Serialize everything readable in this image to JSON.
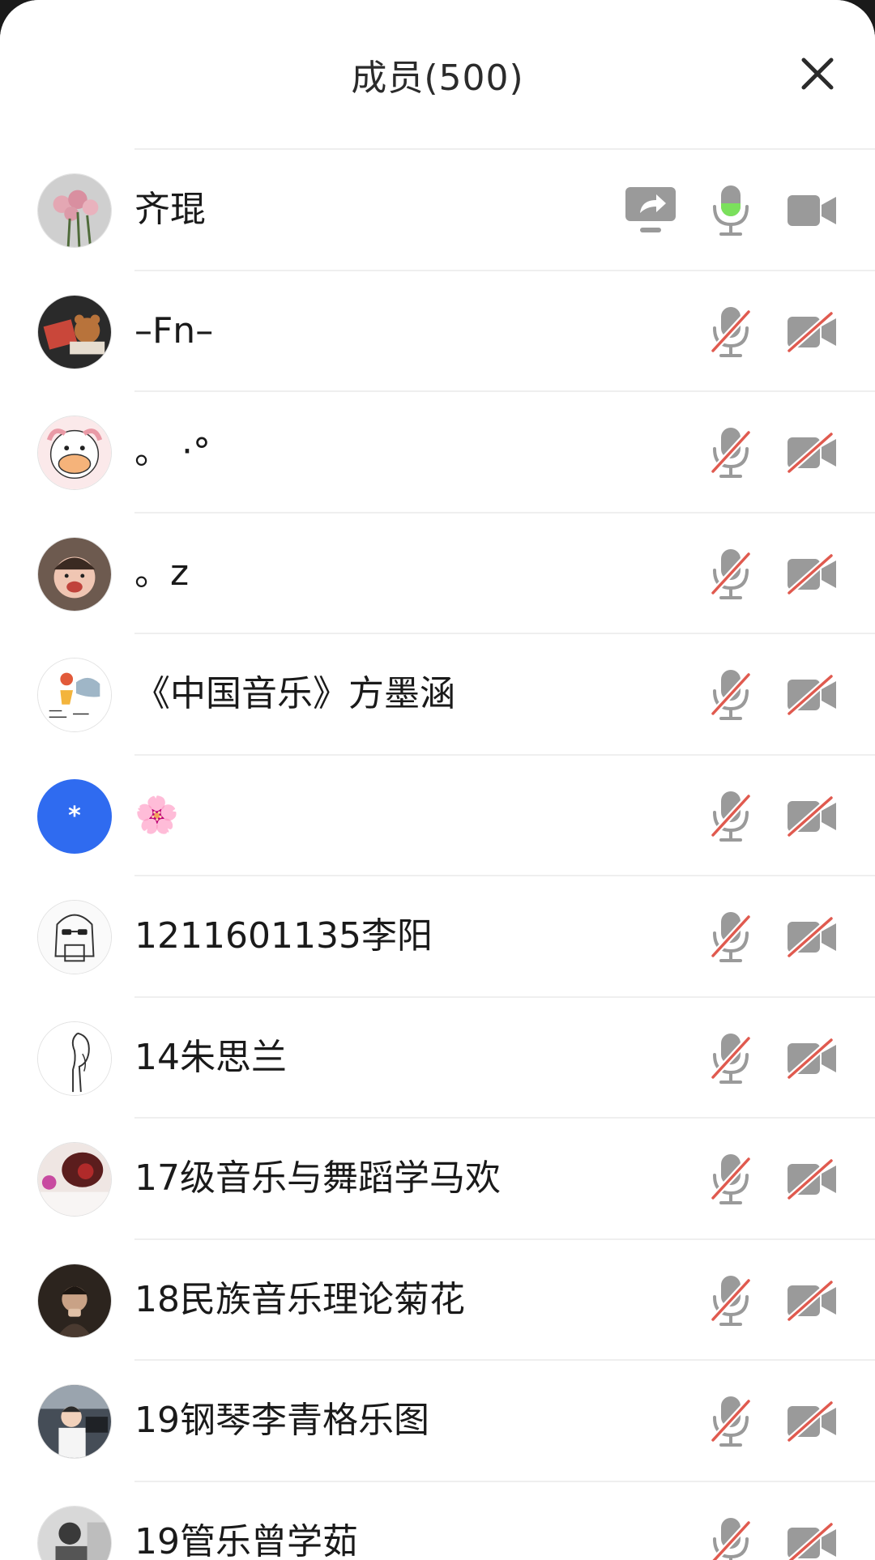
{
  "header": {
    "title": "成员(500)"
  },
  "colors": {
    "muted_icon": "#9a9a9a",
    "slash_red": "#e05a4f",
    "mic_active": "#7be05c",
    "avatar_blue": "#2f6bf0"
  },
  "members": [
    {
      "name": "齐琨",
      "avatar": "flowers-avatar",
      "screen_share": true,
      "mic": "active",
      "camera": "off"
    },
    {
      "name": "–Fn–",
      "avatar": "bear-avatar",
      "screen_share": false,
      "mic": "muted",
      "camera": "disabled"
    },
    {
      "name": "。 ·°",
      "avatar": "cartoon-duck-avatar",
      "screen_share": false,
      "mic": "muted",
      "camera": "disabled"
    },
    {
      "name": "。z",
      "avatar": "child-photo-avatar",
      "screen_share": false,
      "mic": "muted",
      "camera": "disabled"
    },
    {
      "name": "《中国音乐》方墨涵",
      "avatar": "sketch-avatar",
      "screen_share": false,
      "mic": "muted",
      "camera": "disabled"
    },
    {
      "name": "🌸",
      "avatar": "blue-asterisk-avatar",
      "avatar_text": "*",
      "screen_share": false,
      "mic": "muted",
      "camera": "disabled"
    },
    {
      "name": "1211601135李阳",
      "avatar": "sunglasses-girl-avatar",
      "screen_share": false,
      "mic": "muted",
      "camera": "disabled"
    },
    {
      "name": "14朱思兰",
      "avatar": "line-art-girl-avatar",
      "screen_share": false,
      "mic": "muted",
      "camera": "disabled"
    },
    {
      "name": "17级音乐与舞蹈学马欢",
      "avatar": "red-flower-avatar",
      "screen_share": false,
      "mic": "muted",
      "camera": "disabled"
    },
    {
      "name": "18民族音乐理论菊花",
      "avatar": "dark-portrait-avatar",
      "screen_share": false,
      "mic": "muted",
      "camera": "disabled"
    },
    {
      "name": "19钢琴李青格乐图",
      "avatar": "kid-in-car-avatar",
      "screen_share": false,
      "mic": "muted",
      "camera": "disabled"
    },
    {
      "name": "19管乐曾学茹",
      "avatar": "bw-photo-avatar",
      "screen_share": false,
      "mic": "muted",
      "camera": "disabled"
    }
  ]
}
